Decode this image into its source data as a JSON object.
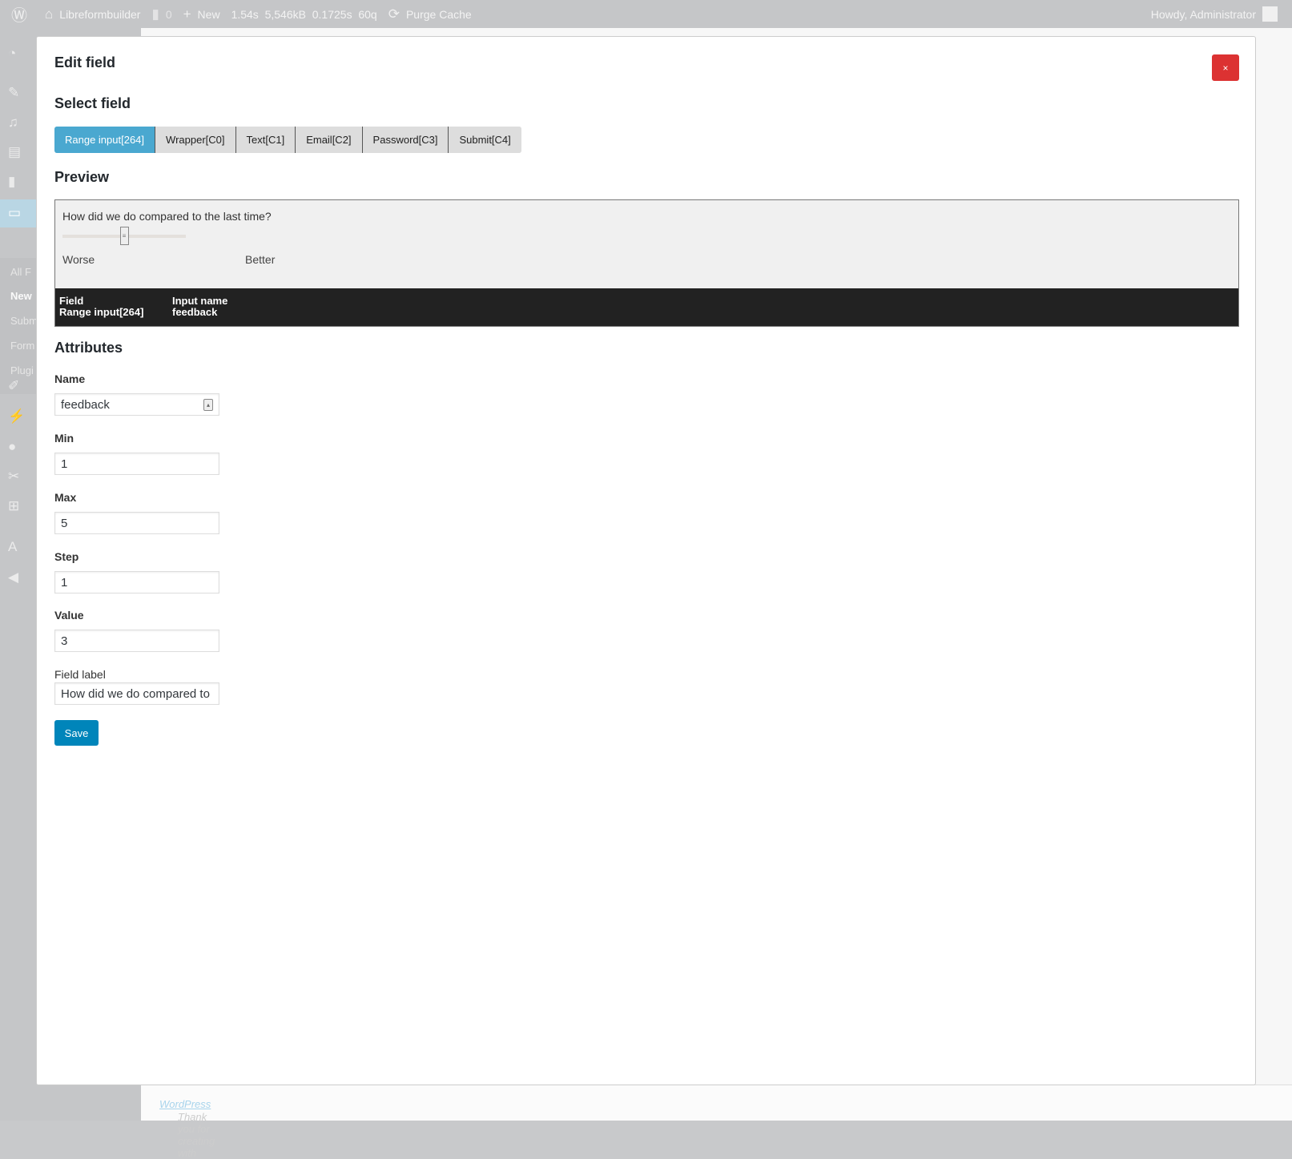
{
  "adminbar": {
    "site": "Libreformbuilder",
    "comments": "0",
    "new": "New",
    "stats": [
      "1.54s",
      "5,546kB",
      "0.1725s",
      "60q"
    ],
    "purge": "Purge Cache",
    "howdy": "Howdy, Administrator"
  },
  "sidebar": {
    "icons": [
      "dashboard-icon",
      "pin-icon",
      "media-icon",
      "pages-icon",
      "comments-icon",
      "forms-icon"
    ],
    "submenu": [
      "All F",
      "New",
      "Subm",
      "Form",
      "Plugi"
    ],
    "icons2": [
      "appearance-icon",
      "plugins-icon",
      "users-icon",
      "tools-icon",
      "settings-icon",
      "translate-icon",
      "collapse-icon"
    ]
  },
  "modal": {
    "title": "Edit field",
    "close": "×",
    "select_heading": "Select field",
    "tabs": [
      "Range input[264]",
      "Wrapper[C0]",
      "Text[C1]",
      "Email[C2]",
      "Password[C3]",
      "Submit[C4]"
    ],
    "active_tab": 0,
    "preview_heading": "Preview",
    "preview": {
      "question": "How did we do compared to the last time?",
      "min": 1,
      "max": 5,
      "value": 3,
      "low_label": "Worse",
      "high_label": "Better",
      "field_label": "Field",
      "field_value": "Range input[264]",
      "input_name_label": "Input name",
      "input_name_value": "feedback"
    },
    "attributes_heading": "Attributes",
    "fields": [
      {
        "label": "Name",
        "value": "feedback"
      },
      {
        "label": "Min",
        "value": "1"
      },
      {
        "label": "Max",
        "value": "5"
      },
      {
        "label": "Step",
        "value": "1"
      },
      {
        "label": "Value",
        "value": "3"
      },
      {
        "label": "Field label",
        "value": "How did we do compared to the last time?"
      }
    ],
    "save": "Save"
  },
  "footer": {
    "text": "Thank you for creating with ",
    "link": "WordPress",
    "end": "."
  },
  "colors": {
    "accent": "#4aa8d0",
    "save": "#0085ba",
    "close": "#dc3232",
    "preview_band": "#222222"
  }
}
